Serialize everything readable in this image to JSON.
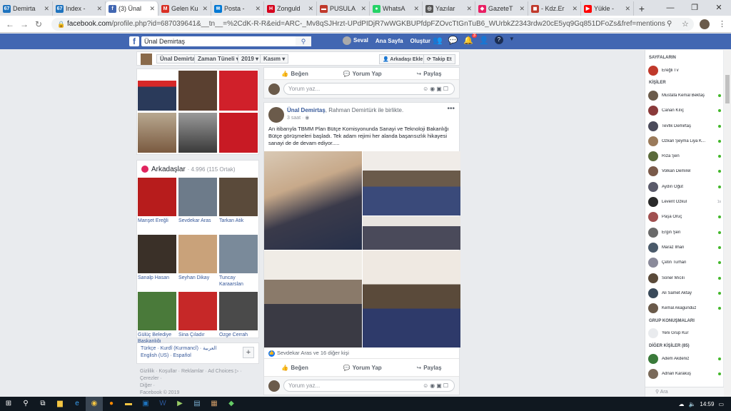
{
  "browser": {
    "tabs": [
      {
        "label": "Demirta",
        "fav": "67",
        "color": "#1e73be"
      },
      {
        "label": "Index -",
        "fav": "67",
        "color": "#1e73be"
      },
      {
        "label": "(3) Ünal",
        "fav": "f",
        "color": "#4267b2",
        "active": true
      },
      {
        "label": "Gelen Ku",
        "fav": "M",
        "color": "#d93025"
      },
      {
        "label": "Posta -",
        "fav": "✉",
        "color": "#0078d4"
      },
      {
        "label": "Zonguld",
        "fav": "H",
        "color": "#d6001c"
      },
      {
        "label": "PUSULA",
        "fav": "▬",
        "color": "#c0392b"
      },
      {
        "label": "WhatsA",
        "fav": "●",
        "color": "#25d366"
      },
      {
        "label": "Yazılar",
        "fav": "◎",
        "color": "#555"
      },
      {
        "label": "GazeteT",
        "fav": "◆",
        "color": "#e91e63"
      },
      {
        "label": "- Kdz.Er",
        "fav": "◼",
        "color": "#c0392b"
      },
      {
        "label": "Yükle -",
        "fav": "▶",
        "color": "#ff0000"
      }
    ],
    "new_tab": "+",
    "url_host": "facebook.com",
    "url_rest": "/profile.php?id=687039641&__tn__=%2CdK-R-R&eid=ARC-_Mv8qSJHrzt-UPdPIDjR7wWGKBUPfdpFZOvcTtGnTuB6_WUrbkZ2343rdw20cE5yq9Gq851DFoZs&fref=mentions"
  },
  "fb": {
    "search_value": "Ünal Demirtaş",
    "user_name": "Seval",
    "home": "Ana Sayfa",
    "create": "Oluştur",
    "notif_count": "3"
  },
  "subnav": {
    "name": "Ünal Demirtaş",
    "timeline": "Zaman Tüneli",
    "year": "2019",
    "month": "Kasım",
    "add_friend": "Arkadaşı Ekle",
    "follow": "Takip Et"
  },
  "friends": {
    "title": "Arkadaşlar",
    "count": "· 4.996 (115 Ortak)",
    "list": [
      {
        "name": "Manşet Ereğli",
        "color": "#b71c1c"
      },
      {
        "name": "Sevdekar Aras",
        "color": "#6d7b8a"
      },
      {
        "name": "Tarkan Atik",
        "color": "#5a4a3a"
      },
      {
        "name": "Sanalp Hasan",
        "color": "#3a3028"
      },
      {
        "name": "Seyhan Dikay",
        "color": "#c9a27a"
      },
      {
        "name": "Tuncay Karaarslan",
        "color": "#7a8a9a"
      },
      {
        "name": "Gülüç Belediye Başkanlığı",
        "color": "#4a7a3a"
      },
      {
        "name": "Sina Çıladır",
        "color": "#c62828"
      },
      {
        "name": "Ozge Cerrah",
        "color": "#4a4a4a"
      }
    ]
  },
  "languages": {
    "line1": "Türkçe · Kurdî (Kurmancî) · العربية",
    "line2": "English (US) · Español",
    "more": "+"
  },
  "footer": {
    "line1": "Gizlilik · Koşullar · Reklamlar · Ad Choices ▷ · Çerezler ·",
    "line2": "Diğer ·",
    "line3": "Facebook © 2019"
  },
  "actions": {
    "like": "Beğen",
    "comment": "Yorum Yap",
    "share": "Paylaş"
  },
  "comment_placeholder": "Yorum yaz...",
  "post": {
    "author": "Ünal Demirtaş",
    "with": ", Rahman Demirtürk ile birlikte.",
    "time": "3 saat · ◉",
    "text": "An itibarıyla TBMM Plan Bütçe Komisyonunda Sanayi ve Teknoloji Bakanlığı Bütçe görüşmeleri başladı. Tek adam rejimi her alanda başarısızlık hikayesi sanayi de de devam ediyor.....",
    "likes": "Sevdekar Aras ve 16 diğer kişi"
  },
  "sidebar": {
    "pages_title": "SAYFALARIN",
    "pages": [
      {
        "name": "Ereğli Tv",
        "color": "#c0392b"
      }
    ],
    "people_title": "KİŞİLER",
    "people": [
      {
        "name": "Mustafa Kemal Bektaş",
        "color": "#6b5b4b",
        "status": "online"
      },
      {
        "name": "Canan Kılıç",
        "color": "#8a3a3a",
        "status": "online"
      },
      {
        "name": "Tevfik Demirtaş",
        "color": "#4a4a5a",
        "status": "online"
      },
      {
        "name": "Özkan Şeyma Liya K...",
        "color": "#9a7a5a",
        "status": "online"
      },
      {
        "name": "Rıza Şen",
        "color": "#5a6a3a",
        "status": "online"
      },
      {
        "name": "Volkan Demirel",
        "color": "#7a5a4a",
        "status": "online"
      },
      {
        "name": "Aydın Öğüt",
        "color": "#5a5a6a",
        "status": "online"
      },
      {
        "name": "Levent Özkul",
        "color": "#2a2a2a",
        "status": "1s"
      },
      {
        "name": "Paşa Oruç",
        "color": "#a05050",
        "status": "online"
      },
      {
        "name": "Ergin Şen",
        "color": "#6a6a6a",
        "status": "online"
      },
      {
        "name": "Maraz İlhan",
        "color": "#4a5a6a",
        "status": "online"
      },
      {
        "name": "Çetin Turhan",
        "color": "#8a8a9a",
        "status": "online"
      },
      {
        "name": "Soner Mıcılı",
        "color": "#5a4a3a",
        "status": "online"
      },
      {
        "name": "Ali Samet Aktay",
        "color": "#3a4a5a",
        "status": "online"
      },
      {
        "name": "Kemal Akagunduz",
        "color": "#6a5a4a",
        "status": "online"
      }
    ],
    "group_title": "GRUP KONUŞMALARI",
    "new_group": "Yeni Grup Kur",
    "other_title": "DİĞER KİŞİLER (85)",
    "others": [
      {
        "name": "Adem Akdeniz",
        "color": "#3a7a3a",
        "status": "online"
      },
      {
        "name": "Adnan Karakuş",
        "color": "#7a6a5a",
        "status": "online"
      }
    ],
    "search_placeholder": "Ara"
  },
  "taskbar": {
    "time": "14:59"
  }
}
